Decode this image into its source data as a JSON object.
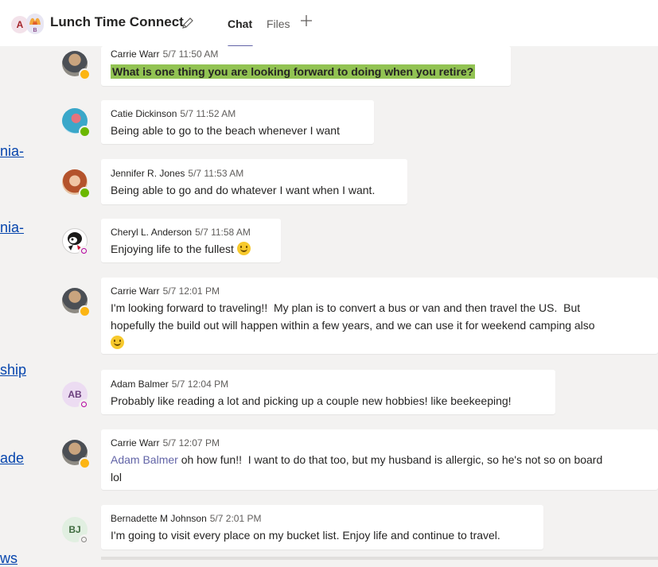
{
  "header": {
    "group_avatar_letter_a": "A",
    "group_avatar_letter_b": "B",
    "title": "Lunch Time Connect",
    "tabs": [
      {
        "label": "Chat"
      },
      {
        "label": "Files"
      }
    ]
  },
  "left_fragments": [
    "nia-",
    "nia-",
    "ship",
    "ade",
    "ws"
  ],
  "messages": [
    {
      "author": "Carrie Warr",
      "time": "5/7 11:50 AM",
      "text": "What is one thing you are looking forward to doing when you retire?"
    },
    {
      "author": "Catie Dickinson",
      "time": "5/7 11:52 AM",
      "text": "Being able to go to the beach whenever I want"
    },
    {
      "author": "Jennifer R. Jones",
      "time": "5/7 11:53 AM",
      "text": "Being able to go and do whatever I want when I want."
    },
    {
      "author": "Cheryl L. Anderson",
      "time": "5/7 11:58 AM",
      "text": "Enjoying life to the fullest"
    },
    {
      "author": "Carrie Warr",
      "time": "5/7 12:01 PM",
      "line1": "I'm looking forward to traveling!!  My plan is to convert a bus or van and then travel the US.  But",
      "line2": "hopefully the build out will happen within a few years, and we can use it for weekend camping also"
    },
    {
      "author": "Adam Balmer",
      "initials": "AB",
      "time": "5/7 12:04 PM",
      "text": "Probably like reading a lot and picking up a couple new hobbies! like beekeeping!"
    },
    {
      "author": "Carrie Warr",
      "time": "5/7 12:07 PM",
      "mention": "Adam Balmer",
      "line1": " oh how fun!!  I want to do that too, but my husband is allergic, so he's not so on board",
      "line2": "lol"
    },
    {
      "author": "Bernadette M Johnson",
      "initials": "BJ",
      "time": "5/7 2:01 PM",
      "text": "I'm going to visit every place on my bucket list. Enjoy life and continue to travel."
    }
  ]
}
